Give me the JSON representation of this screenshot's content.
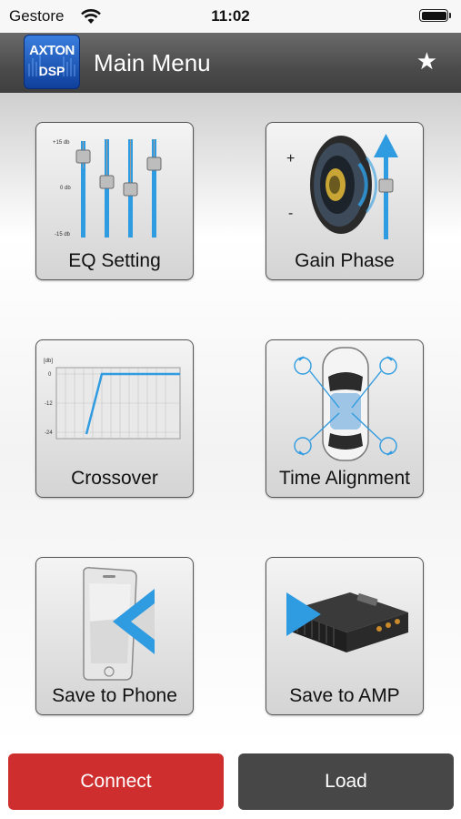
{
  "status_bar": {
    "carrier": "Gestore",
    "time": "11:02"
  },
  "nav": {
    "logo_line1": "AXTON",
    "logo_line2": "DSP",
    "title": "Main Menu",
    "favorite_icon": "star-icon"
  },
  "tiles": [
    {
      "label": "EQ Setting",
      "icon": "equalizer-icon"
    },
    {
      "label": "Gain Phase",
      "icon": "speaker-icon"
    },
    {
      "label": "Crossover",
      "icon": "crossover-chart-icon"
    },
    {
      "label": "Time Alignment",
      "icon": "car-top-view-icon"
    },
    {
      "label": "Save to Phone",
      "icon": "phone-icon"
    },
    {
      "label": "Save to AMP",
      "icon": "amplifier-icon"
    }
  ],
  "eq_art": {
    "scale_top": "+15 db",
    "scale_mid": "0 db",
    "scale_bottom": "-15 db"
  },
  "gain_art": {
    "plus": "+",
    "minus": "-"
  },
  "crossover_art": {
    "unit": "[db]",
    "ticks": [
      "0",
      "-12",
      "-24"
    ]
  },
  "buttons": {
    "connect": "Connect",
    "load": "Load"
  },
  "colors": {
    "accent_blue": "#2f9be0",
    "connect_red": "#cf2e2e",
    "load_gray": "#474747",
    "nav_gray": "#4b4b4b"
  }
}
